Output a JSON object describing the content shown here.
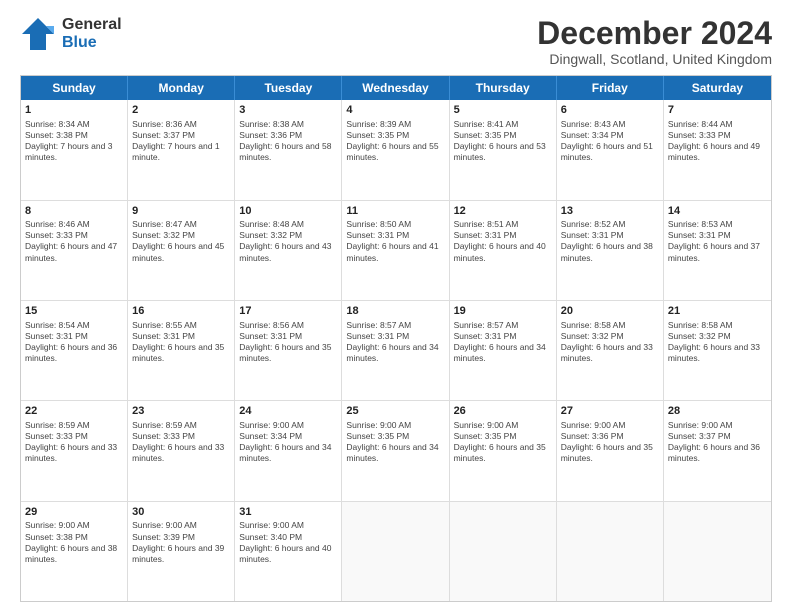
{
  "logo": {
    "general": "General",
    "blue": "Blue"
  },
  "title": {
    "main": "December 2024",
    "sub": "Dingwall, Scotland, United Kingdom"
  },
  "calendar": {
    "headers": [
      "Sunday",
      "Monday",
      "Tuesday",
      "Wednesday",
      "Thursday",
      "Friday",
      "Saturday"
    ],
    "rows": [
      [
        {
          "day": "1",
          "sunrise": "Sunrise: 8:34 AM",
          "sunset": "Sunset: 3:38 PM",
          "daylight": "Daylight: 7 hours and 3 minutes."
        },
        {
          "day": "2",
          "sunrise": "Sunrise: 8:36 AM",
          "sunset": "Sunset: 3:37 PM",
          "daylight": "Daylight: 7 hours and 1 minute."
        },
        {
          "day": "3",
          "sunrise": "Sunrise: 8:38 AM",
          "sunset": "Sunset: 3:36 PM",
          "daylight": "Daylight: 6 hours and 58 minutes."
        },
        {
          "day": "4",
          "sunrise": "Sunrise: 8:39 AM",
          "sunset": "Sunset: 3:35 PM",
          "daylight": "Daylight: 6 hours and 55 minutes."
        },
        {
          "day": "5",
          "sunrise": "Sunrise: 8:41 AM",
          "sunset": "Sunset: 3:35 PM",
          "daylight": "Daylight: 6 hours and 53 minutes."
        },
        {
          "day": "6",
          "sunrise": "Sunrise: 8:43 AM",
          "sunset": "Sunset: 3:34 PM",
          "daylight": "Daylight: 6 hours and 51 minutes."
        },
        {
          "day": "7",
          "sunrise": "Sunrise: 8:44 AM",
          "sunset": "Sunset: 3:33 PM",
          "daylight": "Daylight: 6 hours and 49 minutes."
        }
      ],
      [
        {
          "day": "8",
          "sunrise": "Sunrise: 8:46 AM",
          "sunset": "Sunset: 3:33 PM",
          "daylight": "Daylight: 6 hours and 47 minutes."
        },
        {
          "day": "9",
          "sunrise": "Sunrise: 8:47 AM",
          "sunset": "Sunset: 3:32 PM",
          "daylight": "Daylight: 6 hours and 45 minutes."
        },
        {
          "day": "10",
          "sunrise": "Sunrise: 8:48 AM",
          "sunset": "Sunset: 3:32 PM",
          "daylight": "Daylight: 6 hours and 43 minutes."
        },
        {
          "day": "11",
          "sunrise": "Sunrise: 8:50 AM",
          "sunset": "Sunset: 3:31 PM",
          "daylight": "Daylight: 6 hours and 41 minutes."
        },
        {
          "day": "12",
          "sunrise": "Sunrise: 8:51 AM",
          "sunset": "Sunset: 3:31 PM",
          "daylight": "Daylight: 6 hours and 40 minutes."
        },
        {
          "day": "13",
          "sunrise": "Sunrise: 8:52 AM",
          "sunset": "Sunset: 3:31 PM",
          "daylight": "Daylight: 6 hours and 38 minutes."
        },
        {
          "day": "14",
          "sunrise": "Sunrise: 8:53 AM",
          "sunset": "Sunset: 3:31 PM",
          "daylight": "Daylight: 6 hours and 37 minutes."
        }
      ],
      [
        {
          "day": "15",
          "sunrise": "Sunrise: 8:54 AM",
          "sunset": "Sunset: 3:31 PM",
          "daylight": "Daylight: 6 hours and 36 minutes."
        },
        {
          "day": "16",
          "sunrise": "Sunrise: 8:55 AM",
          "sunset": "Sunset: 3:31 PM",
          "daylight": "Daylight: 6 hours and 35 minutes."
        },
        {
          "day": "17",
          "sunrise": "Sunrise: 8:56 AM",
          "sunset": "Sunset: 3:31 PM",
          "daylight": "Daylight: 6 hours and 35 minutes."
        },
        {
          "day": "18",
          "sunrise": "Sunrise: 8:57 AM",
          "sunset": "Sunset: 3:31 PM",
          "daylight": "Daylight: 6 hours and 34 minutes."
        },
        {
          "day": "19",
          "sunrise": "Sunrise: 8:57 AM",
          "sunset": "Sunset: 3:31 PM",
          "daylight": "Daylight: 6 hours and 34 minutes."
        },
        {
          "day": "20",
          "sunrise": "Sunrise: 8:58 AM",
          "sunset": "Sunset: 3:32 PM",
          "daylight": "Daylight: 6 hours and 33 minutes."
        },
        {
          "day": "21",
          "sunrise": "Sunrise: 8:58 AM",
          "sunset": "Sunset: 3:32 PM",
          "daylight": "Daylight: 6 hours and 33 minutes."
        }
      ],
      [
        {
          "day": "22",
          "sunrise": "Sunrise: 8:59 AM",
          "sunset": "Sunset: 3:33 PM",
          "daylight": "Daylight: 6 hours and 33 minutes."
        },
        {
          "day": "23",
          "sunrise": "Sunrise: 8:59 AM",
          "sunset": "Sunset: 3:33 PM",
          "daylight": "Daylight: 6 hours and 33 minutes."
        },
        {
          "day": "24",
          "sunrise": "Sunrise: 9:00 AM",
          "sunset": "Sunset: 3:34 PM",
          "daylight": "Daylight: 6 hours and 34 minutes."
        },
        {
          "day": "25",
          "sunrise": "Sunrise: 9:00 AM",
          "sunset": "Sunset: 3:35 PM",
          "daylight": "Daylight: 6 hours and 34 minutes."
        },
        {
          "day": "26",
          "sunrise": "Sunrise: 9:00 AM",
          "sunset": "Sunset: 3:35 PM",
          "daylight": "Daylight: 6 hours and 35 minutes."
        },
        {
          "day": "27",
          "sunrise": "Sunrise: 9:00 AM",
          "sunset": "Sunset: 3:36 PM",
          "daylight": "Daylight: 6 hours and 35 minutes."
        },
        {
          "day": "28",
          "sunrise": "Sunrise: 9:00 AM",
          "sunset": "Sunset: 3:37 PM",
          "daylight": "Daylight: 6 hours and 36 minutes."
        }
      ],
      [
        {
          "day": "29",
          "sunrise": "Sunrise: 9:00 AM",
          "sunset": "Sunset: 3:38 PM",
          "daylight": "Daylight: 6 hours and 38 minutes."
        },
        {
          "day": "30",
          "sunrise": "Sunrise: 9:00 AM",
          "sunset": "Sunset: 3:39 PM",
          "daylight": "Daylight: 6 hours and 39 minutes."
        },
        {
          "day": "31",
          "sunrise": "Sunrise: 9:00 AM",
          "sunset": "Sunset: 3:40 PM",
          "daylight": "Daylight: 6 hours and 40 minutes."
        },
        {
          "day": "",
          "sunrise": "",
          "sunset": "",
          "daylight": ""
        },
        {
          "day": "",
          "sunrise": "",
          "sunset": "",
          "daylight": ""
        },
        {
          "day": "",
          "sunrise": "",
          "sunset": "",
          "daylight": ""
        },
        {
          "day": "",
          "sunrise": "",
          "sunset": "",
          "daylight": ""
        }
      ]
    ]
  }
}
